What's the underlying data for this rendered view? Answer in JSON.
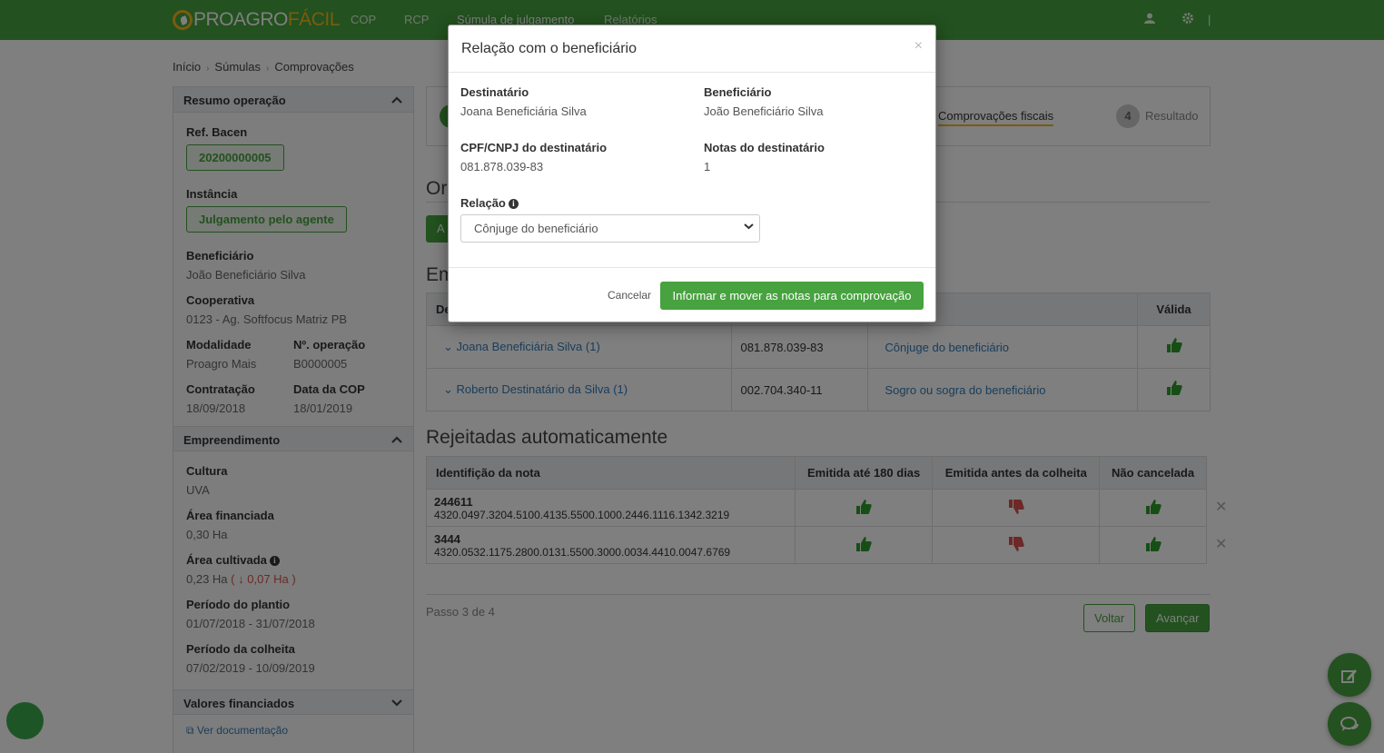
{
  "navbar": {
    "logo_part1": "PROAGRO",
    "logo_part2": "FÁCIL",
    "items": [
      "COP",
      "RCP",
      "Súmula de julgamento",
      "Relatórios"
    ]
  },
  "breadcrumb": [
    "Início",
    "Súmulas",
    "Comprovações"
  ],
  "sidebar": {
    "resumo_title": "Resumo operação",
    "ref_bacen_label": "Ref. Bacen",
    "ref_bacen_value": "20200000005",
    "instancia_label": "Instância",
    "instancia_value": "Julgamento pelo agente",
    "beneficiario_label": "Beneficiário",
    "beneficiario_value": "João Beneficiário Silva",
    "cooperativa_label": "Cooperativa",
    "cooperativa_value": "0123 - Ag. Softfocus Matriz PB",
    "modalidade_label": "Modalidade",
    "modalidade_value": "Proagro Mais",
    "operacao_label": "Nº. operação",
    "operacao_value": "B0000005",
    "contratacao_label": "Contratação",
    "contratacao_value": "18/09/2018",
    "data_cop_label": "Data da COP",
    "data_cop_value": "18/01/2019",
    "empreendimento_title": "Empreendimento",
    "cultura_label": "Cultura",
    "cultura_value": "UVA",
    "area_fin_label": "Área financiada",
    "area_fin_value": "0,30 Ha",
    "area_cult_label": "Área cultivada",
    "area_cult_value": "0,23 Ha",
    "area_cult_diff": "0,07 Ha",
    "plantio_label": "Período do plantio",
    "plantio_value": "01/07/2018 - 31/07/2018",
    "colheita_label": "Período da colheita",
    "colheita_value": "07/02/2019 - 10/09/2019",
    "valores_title": "Valores financiados",
    "doc_link": "Ver documentação"
  },
  "steps": {
    "step3_label": "Comprovações fiscais",
    "step4_number": "4",
    "step4_label": "Resultado"
  },
  "main": {
    "section_partial_1": "Or",
    "button_partial": "A",
    "section_partial_2": "Em",
    "table1_header_partial": "De",
    "table1_header_valid": "Válida",
    "table1_rows": [
      {
        "name": "Joana Beneficiária Silva (1)",
        "cpf": "081.878.039-83",
        "relacao": "Cônjuge do beneficiário"
      },
      {
        "name": "Roberto Destinatário da Silva (1)",
        "cpf": "002.704.340-11",
        "relacao": "Sogro ou sogra do beneficiário"
      }
    ],
    "rejected_title": "Rejeitadas automaticamente",
    "table2_headers": [
      "Identifição da nota",
      "Emitida até 180 dias",
      "Emitida antes da colheita",
      "Não cancelada"
    ],
    "table2_rows": [
      {
        "num": "244611",
        "key": "4320.0497.3204.5100.4135.5500.1000.2446.1116.1342.3219"
      },
      {
        "num": "3444",
        "key": "4320.0532.1175.2800.0131.5500.3000.0034.4410.0047.6769"
      }
    ],
    "step_text": "Passo 3 de 4",
    "back_label": "Voltar",
    "next_label": "Avançar"
  },
  "modal": {
    "title": "Relação com o beneficiário",
    "close": "×",
    "destinatario_label": "Destinatário",
    "destinatario_value": "Joana Beneficiária Silva",
    "beneficiario_label": "Beneficiário",
    "beneficiario_value": "João Beneficiário Silva",
    "cpf_label": "CPF/CNPJ do destinatário",
    "cpf_value": "081.878.039-83",
    "notas_label": "Notas do destinatário",
    "notas_value": "1",
    "relacao_label": "Relação",
    "relacao_selected": "Cônjuge do beneficiário",
    "cancel_label": "Cancelar",
    "submit_label": "Informar e mover as notas para comprovação"
  },
  "colors": {
    "brand_green": "#47a23f",
    "logo_yellow": "#f5b820",
    "link_blue": "#337ab7",
    "danger_red": "#d9534f"
  }
}
